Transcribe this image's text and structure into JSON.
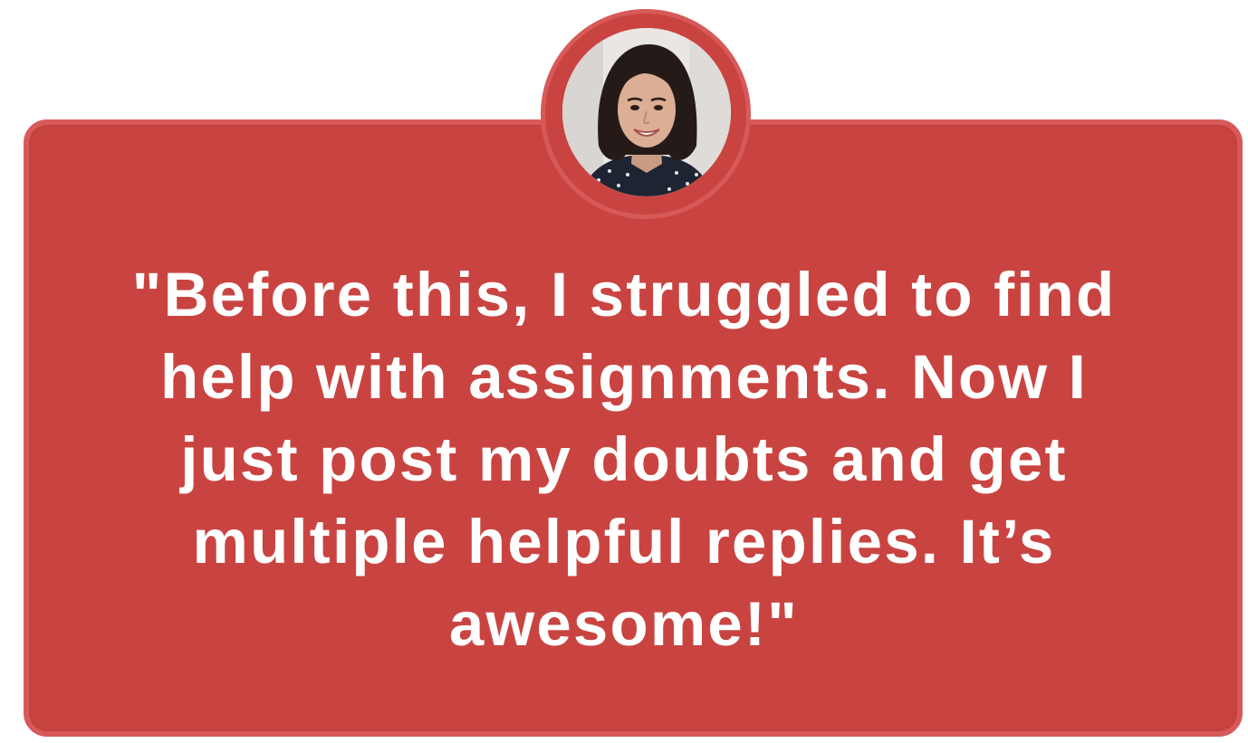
{
  "testimonial": {
    "quote_lines": [
      "\"Before this, I struggled to find",
      "help with assignments. Now I",
      "just post my doubts and get",
      "multiple helpful replies. It’s",
      "awesome!\""
    ],
    "avatar_icon": "woman-portrait-photo"
  },
  "colors": {
    "card_background": "#c94441",
    "card_border": "#d75a58",
    "text": "#ffffff",
    "page_background": "#ffffff"
  }
}
